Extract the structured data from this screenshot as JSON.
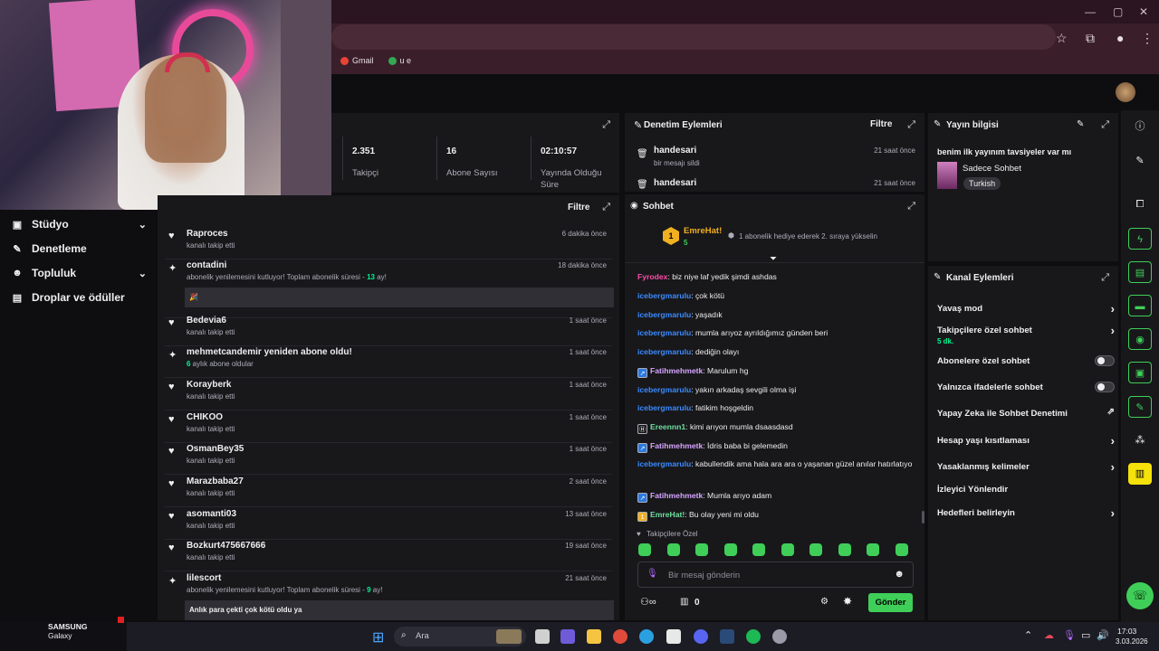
{
  "browser": {
    "bookmarks": [
      {
        "label": "Gmail",
        "color": "#ea4335"
      },
      {
        "label": "u e",
        "color": "#34a853"
      }
    ]
  },
  "sidebar": {
    "items": [
      {
        "label": "Stüdyo",
        "icon": "video-icon",
        "glyph": "▣",
        "chevron": true
      },
      {
        "label": "Denetleme",
        "icon": "wrench-icon",
        "glyph": "✎",
        "chevron": false
      },
      {
        "label": "Topluluk",
        "icon": "people-icon",
        "glyph": "☻",
        "chevron": true
      },
      {
        "label": "Droplar ve ödüller",
        "icon": "gift-icon",
        "glyph": "▤",
        "chevron": false
      }
    ]
  },
  "stats": {
    "items": [
      {
        "value": "2.351",
        "label": "Takipçi"
      },
      {
        "value": "16",
        "label": "Abone Sayısı"
      },
      {
        "value": "02:10:57",
        "label": "Yayında Olduğu Süre"
      }
    ]
  },
  "activity": {
    "filter_label": "Filtre",
    "rows": [
      {
        "name": "Raproces",
        "sub": "kanalı takip etti",
        "time": "6 dakika önce",
        "icon": "heart-icon",
        "glyph": "♥"
      },
      {
        "name": "contadini",
        "sub_pre": "abonelik yenilemesini kutluyor! Toplam abonelik süresi - ",
        "sub_hl": "13",
        "sub_post": " ay!",
        "time": "18 dakika önce",
        "icon": "resub-icon",
        "glyph": "✦",
        "box": "🎉"
      },
      {
        "name": "Bedevia6",
        "sub": "kanalı takip etti",
        "time": "1 saat önce",
        "icon": "heart-icon",
        "glyph": "♥"
      },
      {
        "name": "mehmetcandemir yeniden abone oldu!",
        "sub_hl": "6",
        "sub_post": " aylık abone oldular",
        "time": "1 saat önce",
        "icon": "star-icon",
        "glyph": "✦"
      },
      {
        "name": "Korayberk",
        "sub": "kanalı takip etti",
        "time": "1 saat önce",
        "icon": "heart-icon",
        "glyph": "♥"
      },
      {
        "name": "CHIKOO",
        "sub": "kanalı takip etti",
        "time": "1 saat önce",
        "icon": "heart-icon",
        "glyph": "♥"
      },
      {
        "name": "OsmanBey35",
        "sub": "kanalı takip etti",
        "time": "1 saat önce",
        "icon": "heart-icon",
        "glyph": "♥"
      },
      {
        "name": "Marazbaba27",
        "sub": "kanalı takip etti",
        "time": "2 saat önce",
        "icon": "heart-icon",
        "glyph": "♥"
      },
      {
        "name": "asomanti03",
        "sub": "kanalı takip etti",
        "time": "13 saat önce",
        "icon": "heart-icon",
        "glyph": "♥"
      },
      {
        "name": "Bozkurt475667666",
        "sub": "kanalı takip etti",
        "time": "19 saat önce",
        "icon": "heart-icon",
        "glyph": "♥"
      },
      {
        "name": "lilescort",
        "sub_pre": "abonelik yenilemesini kutluyor! Toplam abonelik süresi - ",
        "sub_hl": "9",
        "sub_post": " ay!",
        "time": "21 saat önce",
        "icon": "resub-icon",
        "glyph": "✦",
        "box": "Anlık para çekti çok kötü oldu ya"
      }
    ]
  },
  "moderation": {
    "title": "Denetim Eylemleri",
    "filter_label": "Filtre",
    "rows": [
      {
        "user": "handesari",
        "action": "bir mesajı sildi",
        "time": "21 saat önce"
      },
      {
        "user": "handesari",
        "action": "",
        "time": "21 saat önce"
      }
    ]
  },
  "chat": {
    "title": "Sohbet",
    "pinned": {
      "rank": "1",
      "user": "EmreHat!",
      "count": "5",
      "text": "1 abonelik hediye ederek 2. sıraya yükselin"
    },
    "messages": [
      {
        "user": "Fyrodex",
        "color": "#ff4aa8",
        "text": ": biz niye laf yedik şimdi ashdas",
        "badge": ""
      },
      {
        "user": "icebergmarulu",
        "color": "#3b8bff",
        "text": ": çok kötü",
        "badge": ""
      },
      {
        "user": "icebergmarulu",
        "color": "#3b8bff",
        "text": ": yaşadık",
        "badge": ""
      },
      {
        "user": "icebergmarulu",
        "color": "#3b8bff",
        "text": ": mumla arıyoz ayrıldığımız günden beri",
        "badge": ""
      },
      {
        "user": "icebergmarulu",
        "color": "#3b8bff",
        "text": ": dediğin olayı",
        "badge": ""
      },
      {
        "user": "Fatihmehmetk",
        "color": "#d7a6ff",
        "text": ": Marulum hg",
        "badge": "vip"
      },
      {
        "user": "icebergmarulu",
        "color": "#3b8bff",
        "text": ": yakın arkadaş sevgili olma işi",
        "badge": ""
      },
      {
        "user": "icebergmarulu",
        "color": "#3b8bff",
        "text": ": fatikim hoşgeldin",
        "badge": ""
      },
      {
        "user": "Ereennn1",
        "color": "#6fe0a0",
        "text": ": kimi arıyon mumla dsaasdasd",
        "badge": "sub"
      },
      {
        "user": "Fatihmehmetk",
        "color": "#d7a6ff",
        "text": ": İdris baba bi gelemedin",
        "badge": "vip"
      },
      {
        "user": "icebergmarulu",
        "color": "#3b8bff",
        "text": ": kabullendik ama hala ara ara o yaşanan güzel anılar hatırlatıyo",
        "badge": ""
      },
      {
        "user": "Fatihmehmetk",
        "color": "#d7a6ff",
        "text": ": Mumla arıyo adam",
        "badge": "vip"
      },
      {
        "user": "EmreHat!",
        "color": "#6fe0a0",
        "text": ": Bu olay yeni mi oldu",
        "badge": "gift"
      }
    ],
    "followers_only": "Takipçilere Özel",
    "input_placeholder": "Bir mesaj gönderin",
    "points": "0",
    "send_label": "Gönder"
  },
  "stream_info": {
    "title": "Yayın bilgisi",
    "stream_title": "benim ilk yayınım tavsiyeler var mı",
    "category": "Sadece Sohbet",
    "tag": "Turkish"
  },
  "channel_actions": {
    "title": "Kanal Eylemleri",
    "items": [
      {
        "label": "Yavaş mod",
        "control": "chevron"
      },
      {
        "label": "Takipçilere özel sohbet",
        "sub": "5 dk.",
        "control": "chevron"
      },
      {
        "label": "Abonelere özel sohbet",
        "control": "toggle"
      },
      {
        "label": "Yalnızca ifadelerle sohbet",
        "control": "toggle"
      },
      {
        "label": "Yapay Zeka ile Sohbet Denetimi",
        "control": "external"
      },
      {
        "label": "Hesap yaşı kısıtlaması",
        "control": "chevron"
      },
      {
        "label": "Yasaklanmış kelimeler",
        "control": "chevron"
      },
      {
        "label": "İzleyici Yönlendir",
        "control": "none"
      },
      {
        "label": "Hedefleri belirleyin",
        "control": "chevron"
      }
    ]
  },
  "taskbar": {
    "device_brand": "SAMSUNG",
    "device_model": "Galaxy",
    "search_placeholder": "Ara",
    "time": "17:03",
    "date": "3.03.2026"
  }
}
